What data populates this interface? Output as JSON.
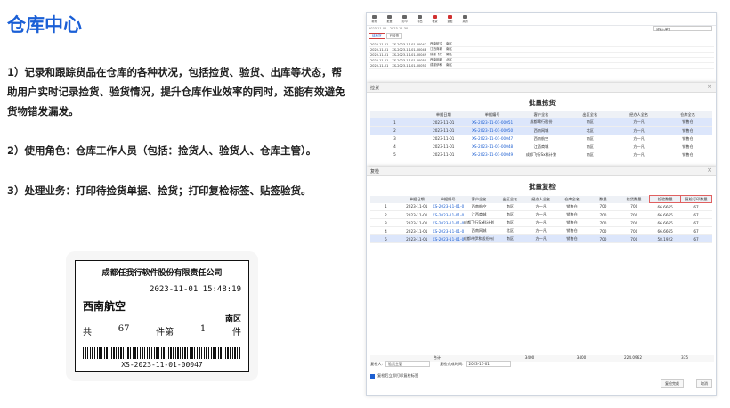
{
  "page_title": "仓库中心",
  "paragraphs": [
    "1）记录和跟踪货品在仓库的各种状况，包括捡货、验货、出库等状态，帮助用户实时记录捡货、验货情况，提升仓库作业效率的同时，还能有效避免货物错发漏发。",
    "2）使用角色：仓库工作人员（包括：捡货人、验货人、仓库主管）。",
    "3）处理业务：打印待捡货单据、捡货；打印复检标签、贴签验货。"
  ],
  "label": {
    "company": "成都任我行软件股份有限责任公司",
    "time": "2023-11-01 15:48:19",
    "destination": "西南航空",
    "area": "南区",
    "total_prefix": "共",
    "total": "67",
    "piece1": "件第",
    "index": "1",
    "piece2": "件",
    "code": "XS-2023-11-01-00047"
  },
  "toolbar": [
    "新增",
    "批量",
    "打印",
    "导出",
    "检货",
    "复检",
    "关闭"
  ],
  "date_range": "2023-11-01 - 2023-11-30",
  "search_placeholder": "请输入单号",
  "tabs": [
    "待检货",
    "已检货"
  ],
  "pick_dialog": {
    "header": "捡货",
    "title": "批量拣货",
    "columns": [
      "单据日期",
      "单据编号",
      "客户全名",
      "出区全名",
      "经办人全名",
      "仓库全名"
    ],
    "rows": [
      [
        "1",
        "2023-11-01",
        "XS-2023-11-01-00051",
        "成都啸行股份",
        "南区",
        "方一凡",
        "销售仓"
      ],
      [
        "2",
        "2023-11-01",
        "XS-2023-11-01-00050",
        "西南网城",
        "北区",
        "方一凡",
        "销售仓"
      ],
      [
        "3",
        "2023-11-01",
        "XS-2023-11-01-00047",
        "西南航空",
        "南区",
        "方一凡",
        "销售仓"
      ],
      [
        "4",
        "2023-11-01",
        "XS-2023-11-01-00048",
        "江西商城",
        "南区",
        "方一凡",
        "销售仓"
      ],
      [
        "5",
        "2023-11-01",
        "XS-2023-11-01-00049",
        "成都飞行Sx科计划",
        "南区",
        "方一凡",
        "销售仓"
      ]
    ]
  },
  "check_dialog": {
    "header": "复检",
    "title": "批量复检",
    "columns": [
      "单据日期",
      "单据编号",
      "客户全名",
      "出区全名",
      "经办人全名",
      "仓库全名",
      "数量",
      "捡货数量",
      "捡验数量",
      "复检打印数量"
    ],
    "rows": [
      [
        "1",
        "2023-11-01",
        "XS-2023-11-01-00047",
        "西南航空",
        "南区",
        "方一凡",
        "销售仓",
        "700",
        "700",
        "66.6665",
        "67"
      ],
      [
        "2",
        "2023-11-01",
        "XS-2023-11-01-00048",
        "江西商城",
        "南区",
        "方一凡",
        "销售仓",
        "700",
        "700",
        "66.6665",
        "67"
      ],
      [
        "3",
        "2023-11-01",
        "XS-2023-11-01-00049",
        "成都飞行Sx科计划",
        "南区",
        "方一凡",
        "销售仓",
        "700",
        "700",
        "66.6665",
        "67"
      ],
      [
        "4",
        "2023-11-01",
        "XS-2023-11-01-00050",
        "西南网城",
        "北区",
        "方一凡",
        "销售仓",
        "700",
        "700",
        "66.6665",
        "67"
      ],
      [
        "5",
        "2023-11-01",
        "XS-2023-11-01-00051",
        "成都市伊和股份有限公司",
        "南区",
        "方一凡",
        "销售仓",
        "700",
        "700",
        "58.1922",
        "67"
      ]
    ],
    "totals": [
      "合计",
      "3400",
      "3400",
      "224.0962",
      "335"
    ],
    "checker_label": "复检人:",
    "checker_value": "验货主管",
    "date_label": "复检完成时间:",
    "date_value": "2023-11-01",
    "option": "复检后立即打印复检标签",
    "btn_confirm": "复检完成",
    "btn_cancel": "取消"
  },
  "bg_rows": [
    [
      "2023-11-01",
      "XS-2023-11-01-00047",
      "西南航空",
      "南区"
    ],
    [
      "2023-11-01",
      "XS-2023-11-01-00048",
      "江西商城",
      "南区"
    ],
    [
      "2023-11-01",
      "XS-2023-11-01-00049",
      "成都飞行",
      "南区"
    ],
    [
      "2023-11-01",
      "XS-2023-11-01-00050",
      "西南网城",
      "北区"
    ],
    [
      "2023-11-01",
      "XS-2023-11-01-00051",
      "成都伊和",
      "南区"
    ]
  ]
}
